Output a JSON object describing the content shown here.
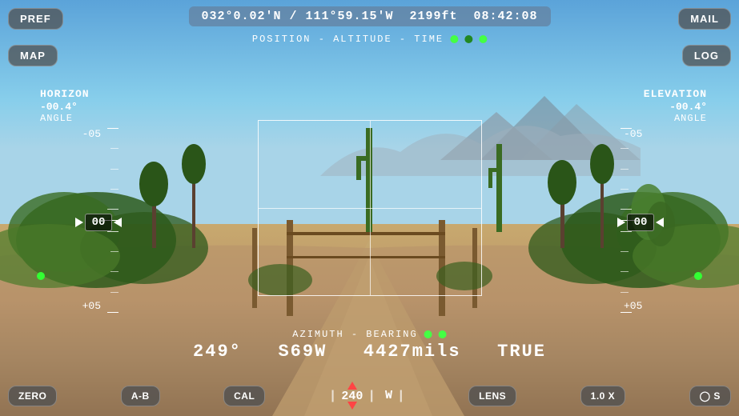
{
  "header": {
    "coordinates": "032°0.02'N / 111°59.15'W",
    "altitude": "2199ft",
    "time": "08:42:08",
    "position_label": "POSITION - ALTITUDE - TIME"
  },
  "buttons": {
    "pref": "PREF",
    "mail": "MAIL",
    "map": "MAP",
    "log": "LOG",
    "zero": "ZERO",
    "ab": "A-B",
    "cal": "CAL",
    "lens": "LENS",
    "zoom": "1.0 X",
    "camera": "⊙ S"
  },
  "gauges": {
    "left": {
      "label": "HORIZON",
      "angle": "-00.4°",
      "angle_label": "ANGLE",
      "top_value": "-05",
      "bottom_value": "+05",
      "zero_value": "00"
    },
    "right": {
      "label": "ELEVATION",
      "angle": "-00.4°",
      "angle_label": "ANGLE",
      "top_value": "-05",
      "bottom_value": "+05",
      "zero_value": "00"
    }
  },
  "azimuth": {
    "label": "AZIMUTH - BEARING",
    "value": "249°",
    "bearing": "S69W",
    "mils": "4427mils",
    "mode": "TRUE"
  },
  "compass": {
    "left_tick": "|",
    "value": "240",
    "west": "W",
    "right_tick": "|"
  }
}
